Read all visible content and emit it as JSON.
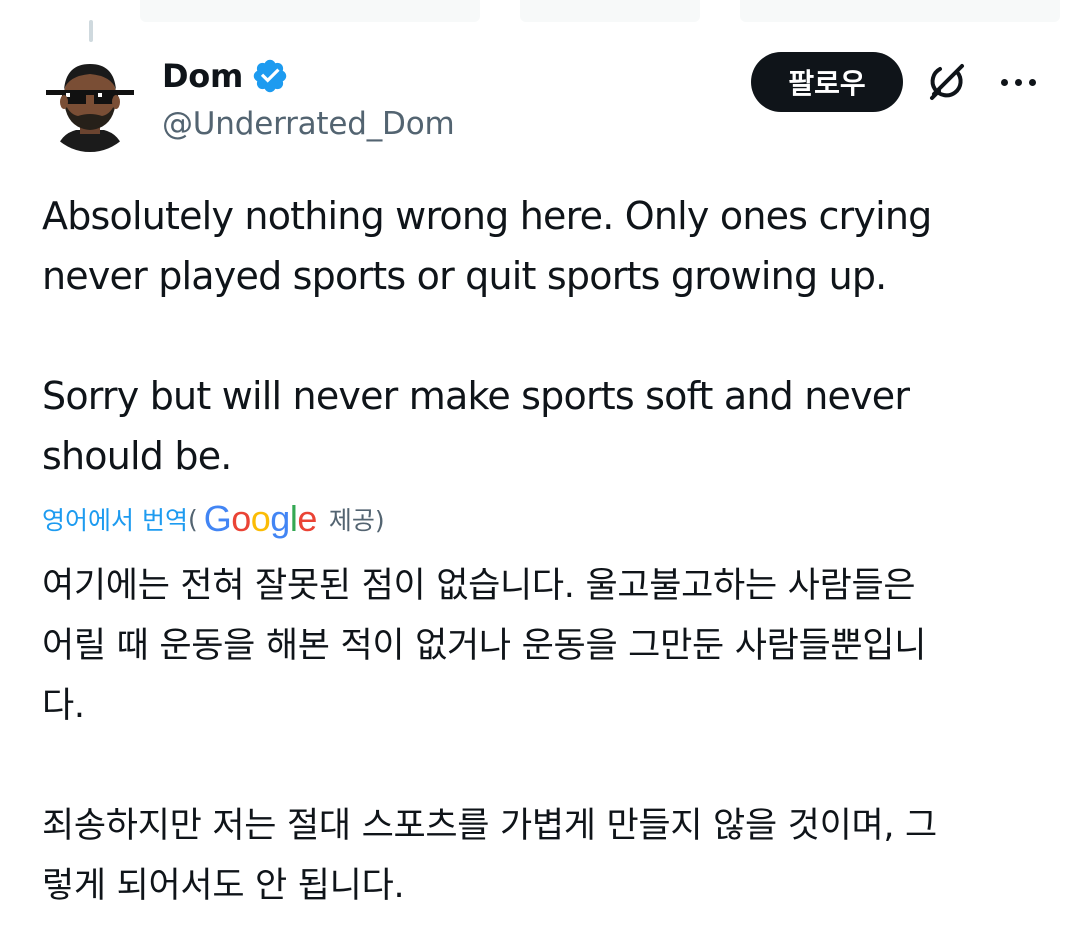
{
  "author": {
    "display_name": "Dom",
    "handle": "@Underrated_Dom",
    "verified": true,
    "verified_color": "#1d9bf0"
  },
  "actions": {
    "follow_label": "팔로우",
    "grok_icon": "grok-icon",
    "more_icon": "more-dots-icon"
  },
  "tweet": {
    "text": "Absolutely nothing wrong here. Only ones crying\nnever played sports or quit sports growing up.\n\nSorry but will never make sports soft and never\nshould be."
  },
  "translation": {
    "link_label": "영어에서 번역",
    "open_paren": "(",
    "provider_logo": "Google",
    "provided_by": "제공)",
    "text": "여기에는 전혀 잘못된 점이 없습니다. 울고불고하는 사람들은\n어릴 때 운동을 해본 적이 없거나 운동을 그만둔 사람들뿐입니\n다.\n\n죄송하지만 저는 절대 스포츠를 가볍게 만들지 않을 것이며, 그\n렇게 되어서도 안 됩니다."
  },
  "colors": {
    "text_primary": "#0f1419",
    "text_secondary": "#536471",
    "link": "#1d9bf0",
    "button_bg": "#0f1419"
  }
}
